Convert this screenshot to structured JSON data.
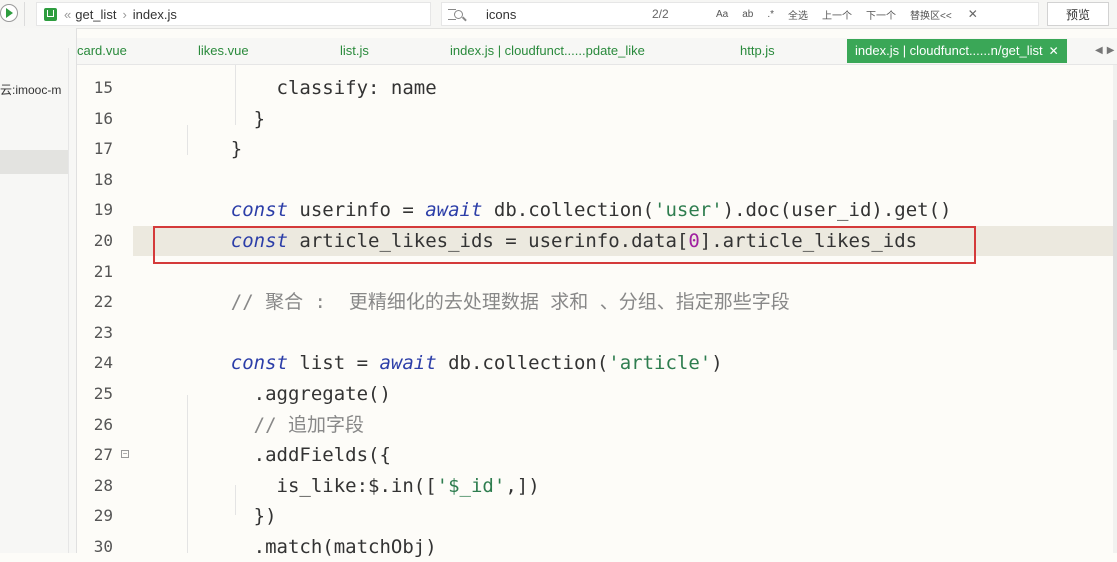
{
  "topbar": {
    "breadcrumb": [
      "get_list",
      "index.js"
    ],
    "search_query": "icons",
    "match_count": "2/2",
    "buttons": {
      "case": "Aa",
      "word": "ab",
      "regex": ".*",
      "select_all": "全选",
      "prev": "上一个",
      "next": "下一个",
      "replace": "替换区<<",
      "close": "✕"
    },
    "preview": "预览"
  },
  "sidebar": {
    "label": "云:imooc-m"
  },
  "tabs": [
    {
      "label": "card.vue"
    },
    {
      "label": "likes.vue"
    },
    {
      "label": "list.js"
    },
    {
      "label": "index.js | cloudfunct......pdate_like"
    },
    {
      "label": "http.js"
    },
    {
      "label": "index.js | cloudfunct......n/get_list",
      "active": true
    }
  ],
  "tab_close": "✕",
  "tab_arrows": "◀▶",
  "editor": {
    "lines": [
      {
        "n": "15",
        "segs": [
          [
            "",
            "        classify: name"
          ]
        ]
      },
      {
        "n": "16",
        "segs": [
          [
            "",
            "      }"
          ]
        ]
      },
      {
        "n": "17",
        "segs": [
          [
            "",
            "    }"
          ]
        ]
      },
      {
        "n": "18",
        "segs": [
          [
            "",
            ""
          ]
        ]
      },
      {
        "n": "19",
        "segs": [
          [
            "kw",
            "    const"
          ],
          [
            "",
            " userinfo = "
          ],
          [
            "kw",
            "await"
          ],
          [
            "",
            " db.collection("
          ],
          [
            "str",
            "'user'"
          ],
          [
            "",
            ").doc(user_id).get()"
          ]
        ]
      },
      {
        "n": "20",
        "segs": [
          [
            "kw",
            "    const"
          ],
          [
            "",
            " article_likes_ids = userinfo.data["
          ],
          [
            "num",
            "0"
          ],
          [
            "",
            "].article_likes_ids"
          ]
        ]
      },
      {
        "n": "21",
        "segs": [
          [
            "",
            ""
          ]
        ]
      },
      {
        "n": "22",
        "segs": [
          [
            "comment",
            "    // 聚合 :  更精细化的去处理数据 求和 、分组、指定那些字段"
          ]
        ]
      },
      {
        "n": "23",
        "segs": [
          [
            "",
            ""
          ]
        ]
      },
      {
        "n": "24",
        "segs": [
          [
            "kw",
            "    const"
          ],
          [
            "",
            " list = "
          ],
          [
            "kw",
            "await"
          ],
          [
            "",
            " db.collection("
          ],
          [
            "str",
            "'article'"
          ],
          [
            "",
            ")"
          ]
        ]
      },
      {
        "n": "25",
        "segs": [
          [
            "",
            "      .aggregate()"
          ]
        ]
      },
      {
        "n": "26",
        "segs": [
          [
            "comment",
            "      // 追加字段"
          ]
        ]
      },
      {
        "n": "27",
        "fold": true,
        "segs": [
          [
            "",
            "      .addFields({"
          ]
        ]
      },
      {
        "n": "28",
        "segs": [
          [
            "",
            "        is_like:$.in(["
          ],
          [
            "str",
            "'$_id'"
          ],
          [
            "",
            ",])"
          ]
        ]
      },
      {
        "n": "29",
        "segs": [
          [
            "",
            "      })"
          ]
        ]
      },
      {
        "n": "30",
        "segs": [
          [
            "",
            "      .match(matchObj)"
          ]
        ]
      }
    ]
  }
}
